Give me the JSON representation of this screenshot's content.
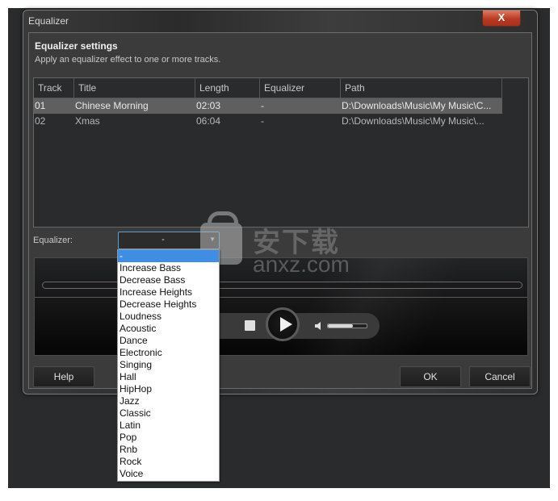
{
  "window": {
    "title": "Equalizer",
    "close_label": "X"
  },
  "panel": {
    "heading": "Equalizer settings",
    "subheading": "Apply an equalizer effect to one or more tracks."
  },
  "tracklist": {
    "columns": [
      "Track",
      "Title",
      "Length",
      "Equalizer",
      "Path"
    ],
    "rows": [
      {
        "track": "01",
        "title": "Chinese Morning",
        "length": "02:03",
        "equalizer": "-",
        "path": "D:\\Downloads\\Music\\My Music\\C...",
        "selected": true
      },
      {
        "track": "02",
        "title": "Xmas",
        "length": "06:04",
        "equalizer": "-",
        "path": "D:\\Downloads\\Music\\My Music\\...",
        "selected": false
      }
    ]
  },
  "equalizer_select": {
    "label": "Equalizer:",
    "value": "-",
    "options": [
      "-",
      "Increase Bass",
      "Decrease Bass",
      "Increase Heights",
      "Decrease Heights",
      "Loudness",
      "Acoustic",
      "Dance",
      "Electronic",
      "Singing",
      "Hall",
      "HipHop",
      "Jazz",
      "Classic",
      "Latin",
      "Pop",
      "Rnb",
      "Rock",
      "Voice"
    ],
    "highlighted": "-"
  },
  "player": {
    "volume_fraction": 0.65
  },
  "buttons": {
    "help": "Help",
    "ok": "OK",
    "cancel": "Cancel"
  },
  "watermark": {
    "cn": "安下载",
    "text": "anxz.com"
  },
  "colors": {
    "highlight": "#3f8ee3",
    "close": "#b83a22",
    "selected_row": "#5f5f60"
  }
}
